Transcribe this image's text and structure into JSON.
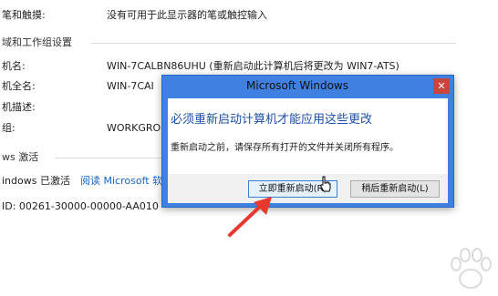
{
  "background": {
    "rows": [
      {
        "label": "笔和触摸:",
        "value": "没有可用于此显示器的笔或触控输入"
      },
      {
        "label": "机名:",
        "value": "WIN-7CALBN86UHU (重新启动此计算机后将更改为 WIN7-ATS)"
      },
      {
        "label": "机全名:",
        "value": "WIN-7CAI"
      },
      {
        "label": "机描述:",
        "value": ""
      },
      {
        "label": "组:",
        "value": "WORKGRO"
      }
    ],
    "section_computer": "域和工作组设置",
    "section_activation": "ws 激活",
    "activation_status": "indows 已激活",
    "activation_link": "阅读 Microsoft 软件",
    "product_id": "ID: 00261-30000-00000-AA010"
  },
  "dialog": {
    "title": "Microsoft Windows",
    "close_label": "✕",
    "heading": "必须重新启动计算机才能应用这些更改",
    "message": "重新启动之前，请保存所有打开的文件并关闭所有程序。",
    "restart_now_label": "立即重新启动(R)",
    "restart_later_label": "稍后重新启动(L)"
  },
  "colors": {
    "dialog_frame": "#3f80e0",
    "heading": "#1f4fa8",
    "link": "#1a64c8",
    "arrow": "#e8392e",
    "close_button": "#c7463b"
  },
  "icons": {
    "cursor": "pointer-cursor-icon",
    "annotation": "red-arrow-icon",
    "watermark": "paw-watermark-icon"
  }
}
